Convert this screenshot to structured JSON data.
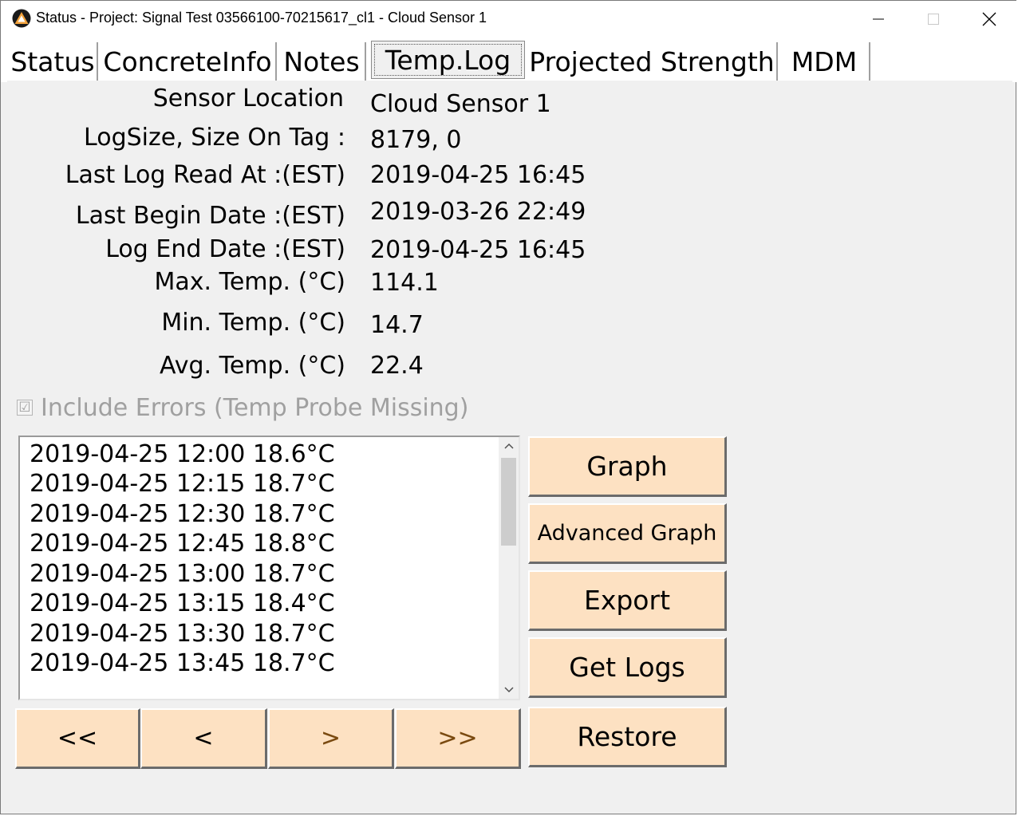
{
  "window": {
    "title": "Status - Project: Signal Test 03566100-70215617_cl1 - Cloud Sensor 1"
  },
  "tabs": [
    {
      "label": "Status"
    },
    {
      "label": "ConcreteInfo"
    },
    {
      "label": "Notes"
    },
    {
      "label": "Temp.Log",
      "active": true
    },
    {
      "label": "Projected Strength"
    },
    {
      "label": "MDM"
    }
  ],
  "fields": [
    {
      "label": "Sensor Location",
      "value": "Cloud Sensor 1"
    },
    {
      "label": "LogSize, Size On Tag :",
      "value": "8179, 0"
    },
    {
      "label": "Last Log Read At :(EST)",
      "value": "2019-04-25 16:45"
    },
    {
      "label": "Last Begin Date :(EST)",
      "value": "2019-03-26 22:49"
    },
    {
      "label": "Log End Date :(EST)",
      "value": "2019-04-25 16:45"
    },
    {
      "label": "Max. Temp. (°C)",
      "value": "114.1"
    },
    {
      "label": "Min. Temp. (°C)",
      "value": "14.7"
    },
    {
      "label": "Avg. Temp. (°C)",
      "value": "22.4"
    }
  ],
  "include_errors": {
    "label": "Include Errors (Temp Probe Missing)",
    "checked": true,
    "enabled": false,
    "check_glyph": "☑"
  },
  "log_entries": [
    "2019-04-25 12:00 18.6°C",
    "2019-04-25 12:15 18.7°C",
    "2019-04-25 12:30 18.7°C",
    "2019-04-25 12:45 18.8°C",
    "2019-04-25 13:00 18.7°C",
    "2019-04-25 13:15 18.4°C",
    "2019-04-25 13:30 18.7°C",
    "2019-04-25 13:45 18.7°C"
  ],
  "buttons": {
    "graph": "Graph",
    "advanced_graph": "Advanced Graph",
    "export": "Export",
    "get_logs": "Get Logs",
    "restore": "Restore"
  },
  "nav": {
    "first": "<<",
    "prev": "<",
    "next": ">",
    "last": ">>"
  },
  "colors": {
    "button_face": "#fde1c2",
    "panel_bg": "#f0f0f0",
    "disabled_text": "#a0a0a0"
  },
  "icons": {
    "app": "warning-triangle-icon",
    "minimize": "minimize-icon",
    "maximize": "maximize-icon",
    "close": "close-icon",
    "scroll_up": "chevron-up-icon",
    "scroll_down": "chevron-down-icon"
  }
}
